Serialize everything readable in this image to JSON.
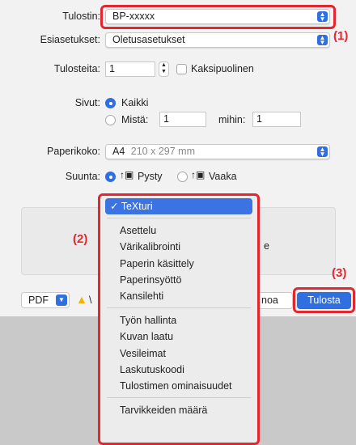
{
  "printer": {
    "label": "Tulostin:",
    "value": "BP-xxxxx"
  },
  "presets": {
    "label": "Esiasetukset:",
    "value": "Oletusasetukset"
  },
  "copies": {
    "label": "Tulosteita:",
    "value": "1",
    "two_sided_label": "Kaksipuolinen"
  },
  "pages": {
    "label": "Sivut:",
    "all_label": "Kaikki",
    "from_label": "Mistä:",
    "from_value": "1",
    "to_label": "mihin:",
    "to_value": "1"
  },
  "paper": {
    "label": "Paperikoko:",
    "size": "A4",
    "dims": "210 x 297 mm"
  },
  "orientation": {
    "label": "Suunta:",
    "portrait": "Pysty",
    "landscape": "Vaaka"
  },
  "menu": {
    "selected": "✓ TeXturi",
    "group1": [
      "Asettelu",
      "Värikalibrointi",
      "Paperin käsittely",
      "Paperinsyöttö",
      "Kansilehti"
    ],
    "group2": [
      "Työn hallinta",
      "Kuvan laatu",
      "Vesileimat",
      "Laskutuskoodi",
      "Tulostimen ominaisuudet"
    ],
    "group3": [
      "Tarvikkeiden määrä"
    ]
  },
  "partial_text": {
    "behind_menu": "e",
    "cancel_partial": "noa"
  },
  "bottom": {
    "pdf_label": "PDF",
    "print_label": "Tulosta"
  },
  "annotations": {
    "one": "(1)",
    "two": "(2)",
    "three": "(3)"
  },
  "colors": {
    "accent": "#2f6fe0",
    "annotation_red": "#e3262f",
    "warning": "#f0b400"
  }
}
